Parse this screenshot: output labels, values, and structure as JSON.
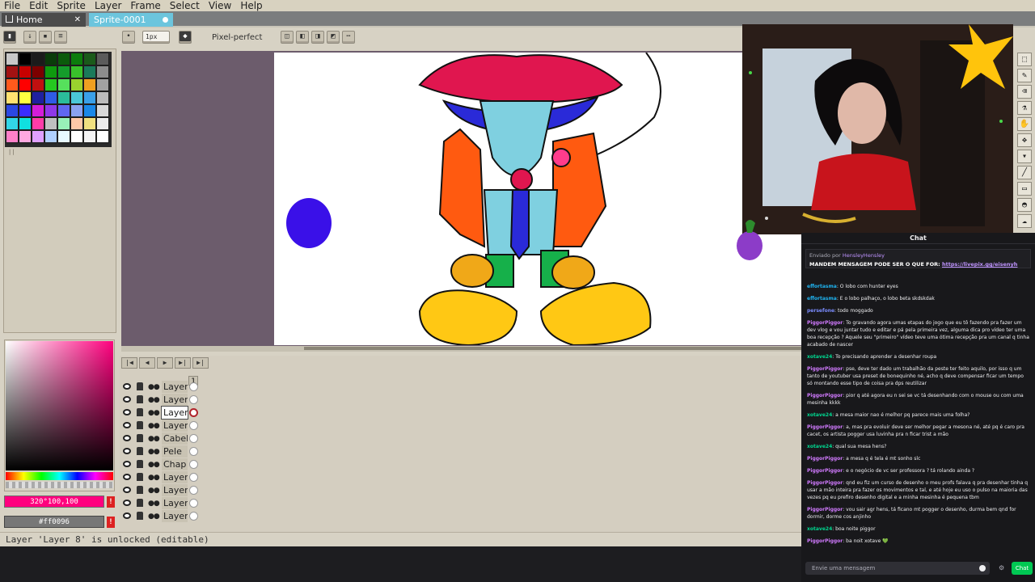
{
  "menu": [
    "File",
    "Edit",
    "Sprite",
    "Layer",
    "Frame",
    "Select",
    "View",
    "Help"
  ],
  "tabs": {
    "home": "Home",
    "sprite": "Sprite-0001"
  },
  "toolbar": {
    "brush_size": "1px",
    "pixel_perfect": "Pixel-perfect"
  },
  "palette_colors": [
    "#c8c8c8",
    "#000000",
    "#1b1b1b",
    "#0a3c0a",
    "#0b5a0b",
    "#0c7c0c",
    "#1a5a1a",
    "#5b5b5b",
    "#a31212",
    "#c80000",
    "#7c0000",
    "#0f9a0f",
    "#159c2b",
    "#39c12b",
    "#1a7a5a",
    "#8c8c8c",
    "#ff5a1c",
    "#ff0000",
    "#c01010",
    "#25c81f",
    "#56e05c",
    "#9ad22e",
    "#f0a021",
    "#a1a1a1",
    "#ffe170",
    "#ffff40",
    "#1f20a0",
    "#2f5be6",
    "#2bbc9a",
    "#4ac8d8",
    "#3aa0e8",
    "#bcbcbc",
    "#2b48e3",
    "#3b2bff",
    "#d41dd8",
    "#8f38e8",
    "#6066f0",
    "#8aa2f0",
    "#1a88e8",
    "#d8d8d8",
    "#32d6e8",
    "#10e0e0",
    "#ff3ca8",
    "#c0c0c0",
    "#98f0b8",
    "#ffc8a8",
    "#f0e080",
    "#ececec",
    "#ff80c8",
    "#ffa8e0",
    "#e0a0ff",
    "#b0d0ff",
    "#e8f8ff",
    "#ffffff",
    "#f4f4f4",
    "#ffffff"
  ],
  "color_picker": {
    "fg_value": "320°100,100",
    "bg_value": "#ff0096"
  },
  "timeline": {
    "frame_number": "1",
    "layers": [
      {
        "name": "Layer",
        "selected": false
      },
      {
        "name": "Layer",
        "selected": false
      },
      {
        "name": "Layer",
        "selected": true
      },
      {
        "name": "Layer",
        "selected": false
      },
      {
        "name": "Cabel",
        "selected": false
      },
      {
        "name": "Pele",
        "selected": false
      },
      {
        "name": "Chap",
        "selected": false
      },
      {
        "name": "Layer",
        "selected": false
      },
      {
        "name": "Layer",
        "selected": false
      },
      {
        "name": "Layer",
        "selected": false
      },
      {
        "name": "Layer",
        "selected": false
      }
    ]
  },
  "status": "Layer 'Layer 8' is unlocked (editable)",
  "chat": {
    "title": "Chat",
    "pinned": {
      "by_label": "Enviado por",
      "user": "HensleyHensley",
      "text": "MANDEM MENSAGEM PODE SER O QUE FOR:",
      "link": "https://livepix.gg/eisenyh"
    },
    "messages": [
      {
        "user": "effortasma",
        "color": "#1fb3f0",
        "text": ": O lobo com hunter eyes"
      },
      {
        "user": "effortasma",
        "color": "#1fb3f0",
        "text": ": E o lobo palhaço, o lobo beta skdskdak"
      },
      {
        "user": "persefone",
        "color": "#7b8cff",
        "text": ": todo moggado"
      },
      {
        "user": "PiggorPiggor",
        "color": "#d17aff",
        "text": ": To gravando agora umas etapas do jogo que eu tô fazendo pra fazer um dev vlog e vou juntar tudo e editar e pá pela primeira vez, alguma dica pro vídeo ter uma boa recepção ? Aquele seu \"primeiro\" vídeo teve uma ótima recepção pra um canal q tinha acabado de nascer"
      },
      {
        "user": "xotave24",
        "color": "#00d68f",
        "text": ": To precisando aprender a desenhar roupa"
      },
      {
        "user": "PiggorPiggor",
        "color": "#d17aff",
        "text": ": pse, deve ter dado um trabalhão da peste ter feito aquilo, por isso q um tanto de youtuber usa preset de bonequinho né, acho q deve compensar ficar um tempo só montando esse tipo de coisa pra dps reutilizar"
      },
      {
        "user": "PiggorPiggor",
        "color": "#d17aff",
        "text": ": pior q até agora eu n sei se vc tá desenhando com o mouse ou com uma mesinha kkkk"
      },
      {
        "user": "xotave24",
        "color": "#00d68f",
        "text": ": a mesa maior nao é melhor pq parece mais uma folha?"
      },
      {
        "user": "PiggorPiggor",
        "color": "#d17aff",
        "text": ": a, mas pra evoluir deve ser melhor pegar a mesona né, até pq é caro pra cacet, os artista pogger usa luvinha pra n ficar trist a mão"
      },
      {
        "user": "xotave24",
        "color": "#00d68f",
        "text": ": qual sua mesa hens?"
      },
      {
        "user": "PiggorPiggor",
        "color": "#d17aff",
        "text": ": a mesa q é tela é mt sonho slc"
      },
      {
        "user": "PiggorPiggor",
        "color": "#d17aff",
        "text": ": e o negócio de vc ser professora ? tá rolando ainda ?"
      },
      {
        "user": "PiggorPiggor",
        "color": "#d17aff",
        "text": ": qnd eu fiz um curso de desenho o meu profs falava q pra desenhar tinha q usar a mão inteira pra fazer os movimentos e tal, e até hoje eu uso o pulso na maioria das vezes pq eu prefiro desenho digital e a minha mesinha é pequena tbm"
      },
      {
        "user": "PiggorPiggor",
        "color": "#d17aff",
        "text": ": vou sair agr hens, tá ficano mt pogger o desenho, durma bem qnd for dormir, dorme cos anjinho"
      },
      {
        "user": "xotave24",
        "color": "#00d68f",
        "text": ": boa noite piggor"
      },
      {
        "user": "PiggorPiggor",
        "color": "#d17aff",
        "text": ": ba noit xotave 💚"
      }
    ],
    "input_placeholder": "Envie uma mensagem",
    "send_label": "Chat"
  }
}
